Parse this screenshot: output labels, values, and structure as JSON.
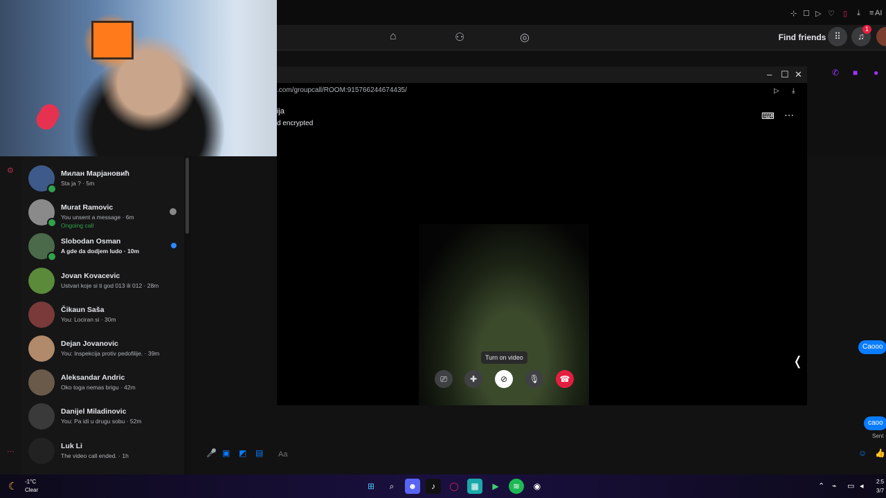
{
  "browser": {
    "top_icons": [
      "pin-icon",
      "tab-icon",
      "play-icon",
      "heart-icon",
      "mirror-icon",
      "download-icon",
      "menu-icon",
      "user-icon",
      "extension-icon"
    ],
    "top_label": "AI"
  },
  "fb_nav": {
    "find_friends": "Find friends",
    "notification_count": "1"
  },
  "chats": [
    {
      "name": "Милан Марјановић",
      "preview": "Sta ja ? · 5m",
      "online": true,
      "avatar_color": "#3d5a8a"
    },
    {
      "name": "Murat Ramovic",
      "preview": "You unsent a message · 6m",
      "status": "Ongoing call",
      "online": true,
      "avatar_color": "#8a8a8a"
    },
    {
      "name": "Slobodan Osman",
      "preview": "A gde da dodjem ludo · 10m",
      "online": true,
      "unread": true,
      "avatar_color": "#4a6a4a"
    },
    {
      "name": "Jovan Kovacevic",
      "preview": "Ustvari koje si ti god 013 ili 012 · 28m",
      "online": false,
      "avatar_color": "#5a8a3a"
    },
    {
      "name": "Čikaun Saša",
      "preview": "You: Lociran si · 30m",
      "online": false,
      "avatar_color": "#7a3a3a"
    },
    {
      "name": "Dejan Jovanovic",
      "preview": "You: Inspekcija protiv pedofilije. · 39m",
      "online": false,
      "avatar_color": "#b08a6a"
    },
    {
      "name": "Aleksandar Andric",
      "preview": "Oko toga nemas brigu · 42m",
      "online": false,
      "avatar_color": "#6a5a4a"
    },
    {
      "name": "Danijel Miladinovic",
      "preview": "You: Pa idi u drugu sobu · 52m",
      "online": false,
      "avatar_color": "#3a3a3a"
    },
    {
      "name": "Luk Li",
      "preview": "The video call ended. · 1h",
      "online": false,
      "avatar_color": "#222222"
    }
  ],
  "call": {
    "url": ".com/groupcall/ROOM:915766244674435/",
    "title": "ija",
    "subtitle": "d encrypted",
    "tooltip": "Turn on video"
  },
  "messages": [
    {
      "text": "Caooo"
    },
    {
      "text": "caoo"
    }
  ],
  "sent_label": "Sent",
  "composer": {
    "placeholder": "Aa"
  },
  "taskbar": {
    "temp": "-1°C",
    "weather": "Clear",
    "time": "2:5",
    "date": "3/7"
  }
}
